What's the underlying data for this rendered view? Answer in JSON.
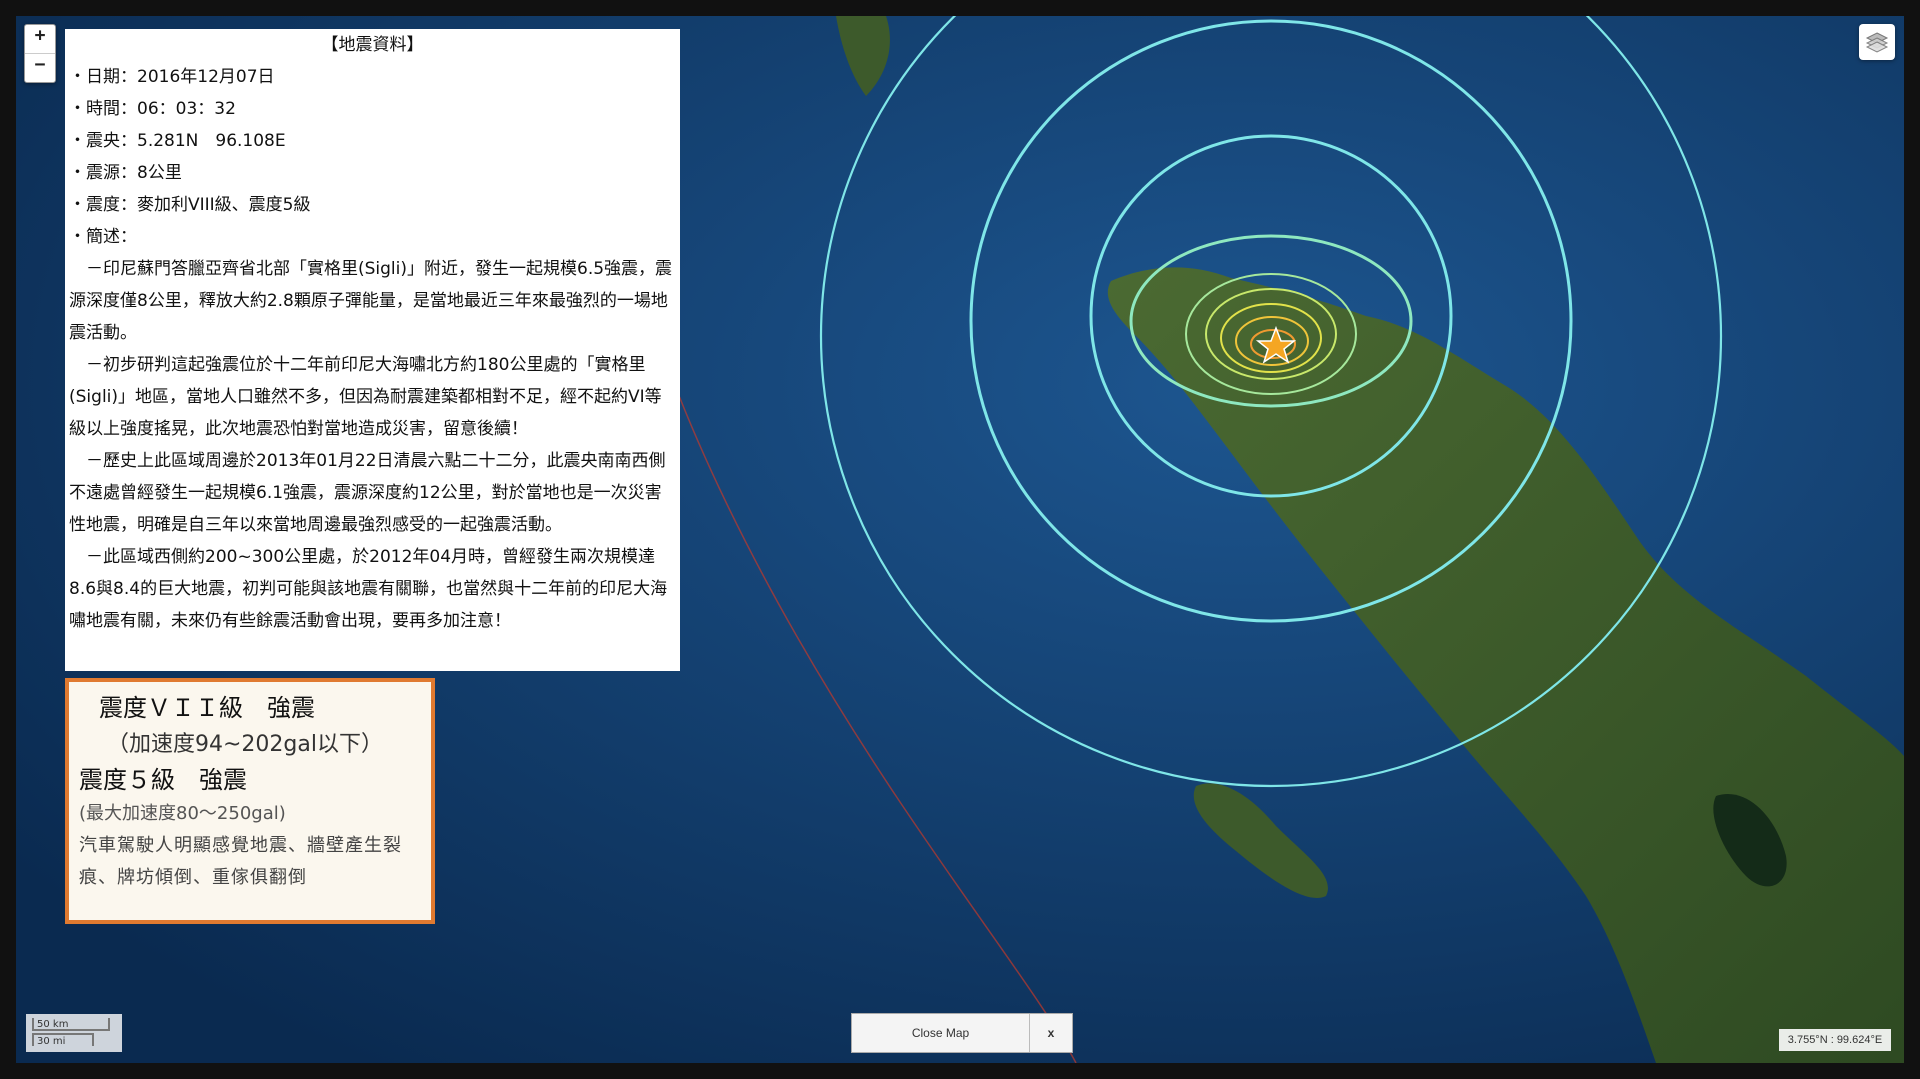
{
  "map": {
    "zoom_in": "+",
    "zoom_out": "−",
    "layers_icon": "layers-icon",
    "scale_km": "50 km",
    "scale_mi": "30 mi",
    "close_label": "Close Map",
    "close_x": "x",
    "coordinates": "3.755°N : 99.624°E",
    "colors": {
      "contour": "#7fe6e8",
      "epicenter": "#f5a623",
      "ocean": "#0f3a66",
      "land": "#3f5d2c",
      "intensity_border": "#e07a30"
    }
  },
  "info": {
    "title": "【地震資料】",
    "date": "・日期：2016年12月07日",
    "time": "・時間：06：03：32",
    "epicenter": "・震央：5.281N　96.108E",
    "depth": "・震源：8公里",
    "intensity": "・震度：麥加利VIII級、震度5級",
    "summary_label": "・簡述：",
    "p1": "　－印尼蘇門答臘亞齊省北部「實格里(Sigli)」附近，發生一起規模6.5強震，震源深度僅8公里，釋放大約2.8顆原子彈能量，是當地最近三年來最強烈的一場地震活動。",
    "p2": "　－初步研判這起強震位於十二年前印尼大海嘯北方約180公里處的「實格里(Sigli)」地區，當地人口雖然不多，但因為耐震建築都相對不足，經不起約VI等級以上強度搖晃，此次地震恐怕對當地造成災害，留意後續！",
    "p3": "　－歷史上此區域周邊於2013年01月22日清晨六點二十二分，此震央南南西側不遠處曾經發生一起規模6.1強震，震源深度約12公里，對於當地也是一次災害性地震，明確是自三年以來當地周邊最強烈感受的一起強震活動。",
    "p4": "　－此區域西側約200~300公里處，於2012年04月時，曾經發生兩次規模達8.6與8.4的巨大地震，初判可能與該地震有關聯，也當然與十二年前的印尼大海嘯地震有關，未來仍有些餘震活動會出現，要再多加注意！"
  },
  "intensity_box": {
    "line1": "震度ＶＩＩ級　強震",
    "line2": "（加速度94~202gal以下）",
    "line3": "震度５級　強震",
    "line4": "(最大加速度80～250gal)",
    "line5": "汽車駕駛人明顯感覺地震、牆壁產生裂痕、牌坊傾倒、重傢俱翻倒"
  }
}
